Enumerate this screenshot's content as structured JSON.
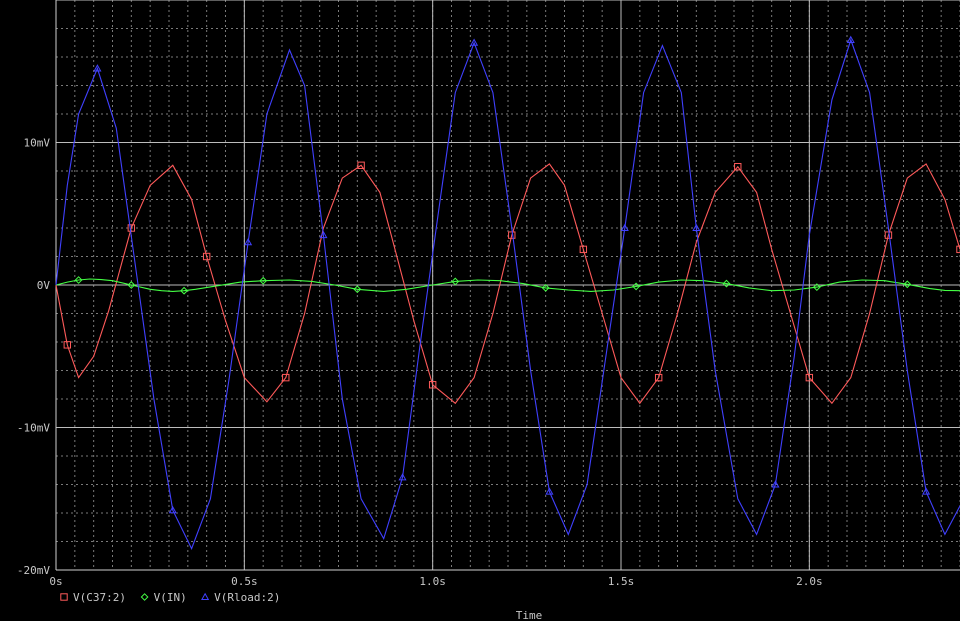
{
  "chart_data": {
    "type": "line",
    "xlabel": "Time",
    "ylabel": "",
    "x_unit": "s",
    "xlim": [
      0,
      2.4
    ],
    "ylim": [
      -20,
      20
    ],
    "x_ticks": [
      {
        "v": 0,
        "label": "0s"
      },
      {
        "v": 0.5,
        "label": "0.5s"
      },
      {
        "v": 1.0,
        "label": "1.0s"
      },
      {
        "v": 1.5,
        "label": "1.5s"
      },
      {
        "v": 2.0,
        "label": "2.0s"
      }
    ],
    "y_ticks": [
      {
        "v": 10,
        "label": "10mV"
      },
      {
        "v": 0,
        "label": "0V"
      },
      {
        "v": -10,
        "label": "-10mV"
      },
      {
        "v": -20,
        "label": "-20mV"
      }
    ],
    "grid": true,
    "legend_position": "bottom-left",
    "series": [
      {
        "name": "V(C37:2)",
        "color": "#ff5a5a",
        "marker": "square",
        "points": [
          [
            0,
            0
          ],
          [
            0.03,
            -4.2
          ],
          [
            0.06,
            -6.5
          ],
          [
            0.1,
            -5.0
          ],
          [
            0.14,
            -1.8
          ],
          [
            0.2,
            4.0
          ],
          [
            0.25,
            7.0
          ],
          [
            0.31,
            8.4
          ],
          [
            0.36,
            6.0
          ],
          [
            0.4,
            2.0
          ],
          [
            0.45,
            -2.5
          ],
          [
            0.5,
            -6.5
          ],
          [
            0.56,
            -8.2
          ],
          [
            0.61,
            -6.5
          ],
          [
            0.66,
            -2.0
          ],
          [
            0.71,
            4.0
          ],
          [
            0.76,
            7.5
          ],
          [
            0.81,
            8.4
          ],
          [
            0.86,
            6.5
          ],
          [
            0.9,
            2.5
          ],
          [
            0.95,
            -2.5
          ],
          [
            1.0,
            -7.0
          ],
          [
            1.06,
            -8.3
          ],
          [
            1.11,
            -6.5
          ],
          [
            1.16,
            -2.0
          ],
          [
            1.21,
            3.5
          ],
          [
            1.26,
            7.5
          ],
          [
            1.31,
            8.5
          ],
          [
            1.35,
            7.0
          ],
          [
            1.4,
            2.5
          ],
          [
            1.45,
            -2.0
          ],
          [
            1.5,
            -6.5
          ],
          [
            1.55,
            -8.3
          ],
          [
            1.6,
            -6.5
          ],
          [
            1.65,
            -2.0
          ],
          [
            1.7,
            3.0
          ],
          [
            1.75,
            6.5
          ],
          [
            1.81,
            8.3
          ],
          [
            1.86,
            6.5
          ],
          [
            1.9,
            2.5
          ],
          [
            1.95,
            -2.0
          ],
          [
            2.0,
            -6.5
          ],
          [
            2.06,
            -8.3
          ],
          [
            2.11,
            -6.5
          ],
          [
            2.16,
            -2.0
          ],
          [
            2.21,
            3.5
          ],
          [
            2.26,
            7.5
          ],
          [
            2.31,
            8.5
          ],
          [
            2.36,
            6.0
          ],
          [
            2.4,
            2.5
          ]
        ]
      },
      {
        "name": "V(IN)",
        "color": "#44ff44",
        "marker": "diamond",
        "points": [
          [
            0,
            0
          ],
          [
            0.03,
            0.2
          ],
          [
            0.06,
            0.35
          ],
          [
            0.09,
            0.42
          ],
          [
            0.12,
            0.38
          ],
          [
            0.15,
            0.3
          ],
          [
            0.2,
            0
          ],
          [
            0.25,
            -0.3
          ],
          [
            0.28,
            -0.4
          ],
          [
            0.31,
            -0.45
          ],
          [
            0.34,
            -0.4
          ],
          [
            0.37,
            -0.3
          ],
          [
            0.43,
            -0.05
          ],
          [
            0.49,
            0.2
          ],
          [
            0.55,
            0.3
          ],
          [
            0.62,
            0.35
          ],
          [
            0.68,
            0.25
          ],
          [
            0.74,
            0
          ],
          [
            0.8,
            -0.3
          ],
          [
            0.87,
            -0.45
          ],
          [
            0.93,
            -0.3
          ],
          [
            1.0,
            0
          ],
          [
            1.06,
            0.25
          ],
          [
            1.12,
            0.35
          ],
          [
            1.18,
            0.3
          ],
          [
            1.24,
            0.1
          ],
          [
            1.3,
            -0.2
          ],
          [
            1.36,
            -0.35
          ],
          [
            1.42,
            -0.45
          ],
          [
            1.48,
            -0.35
          ],
          [
            1.54,
            -0.1
          ],
          [
            1.6,
            0.2
          ],
          [
            1.66,
            0.35
          ],
          [
            1.72,
            0.3
          ],
          [
            1.78,
            0.1
          ],
          [
            1.84,
            -0.2
          ],
          [
            1.9,
            -0.4
          ],
          [
            1.96,
            -0.35
          ],
          [
            2.02,
            -0.15
          ],
          [
            2.08,
            0.2
          ],
          [
            2.14,
            0.35
          ],
          [
            2.2,
            0.3
          ],
          [
            2.26,
            0.05
          ],
          [
            2.32,
            -0.25
          ],
          [
            2.36,
            -0.38
          ],
          [
            2.4,
            -0.4
          ]
        ]
      },
      {
        "name": "V(Rload:2)",
        "color": "#4040ff",
        "marker": "triangle",
        "points": [
          [
            0,
            0
          ],
          [
            0.03,
            7.0
          ],
          [
            0.06,
            12.0
          ],
          [
            0.11,
            15.2
          ],
          [
            0.16,
            11.0
          ],
          [
            0.21,
            1.5
          ],
          [
            0.26,
            -8.0
          ],
          [
            0.31,
            -15.8
          ],
          [
            0.36,
            -18.5
          ],
          [
            0.41,
            -15.0
          ],
          [
            0.46,
            -6.5
          ],
          [
            0.51,
            3.0
          ],
          [
            0.56,
            12.0
          ],
          [
            0.62,
            16.5
          ],
          [
            0.66,
            14.0
          ],
          [
            0.71,
            3.5
          ],
          [
            0.76,
            -8.0
          ],
          [
            0.81,
            -15.0
          ],
          [
            0.87,
            -17.8
          ],
          [
            0.92,
            -13.5
          ],
          [
            0.97,
            -3.5
          ],
          [
            1.02,
            6.0
          ],
          [
            1.06,
            13.5
          ],
          [
            1.11,
            17.0
          ],
          [
            1.16,
            13.5
          ],
          [
            1.21,
            4.0
          ],
          [
            1.26,
            -6.0
          ],
          [
            1.31,
            -14.5
          ],
          [
            1.36,
            -17.5
          ],
          [
            1.41,
            -14.0
          ],
          [
            1.46,
            -5.0
          ],
          [
            1.51,
            4.0
          ],
          [
            1.56,
            13.5
          ],
          [
            1.61,
            16.8
          ],
          [
            1.66,
            13.5
          ],
          [
            1.7,
            4.0
          ],
          [
            1.75,
            -6.0
          ],
          [
            1.81,
            -15.0
          ],
          [
            1.86,
            -17.5
          ],
          [
            1.91,
            -14.0
          ],
          [
            1.96,
            -5.0
          ],
          [
            2.0,
            3.5
          ],
          [
            2.06,
            13.0
          ],
          [
            2.11,
            17.2
          ],
          [
            2.16,
            13.5
          ],
          [
            2.21,
            4.0
          ],
          [
            2.26,
            -6.0
          ],
          [
            2.31,
            -14.5
          ],
          [
            2.36,
            -17.5
          ],
          [
            2.4,
            -15.5
          ]
        ]
      }
    ]
  }
}
